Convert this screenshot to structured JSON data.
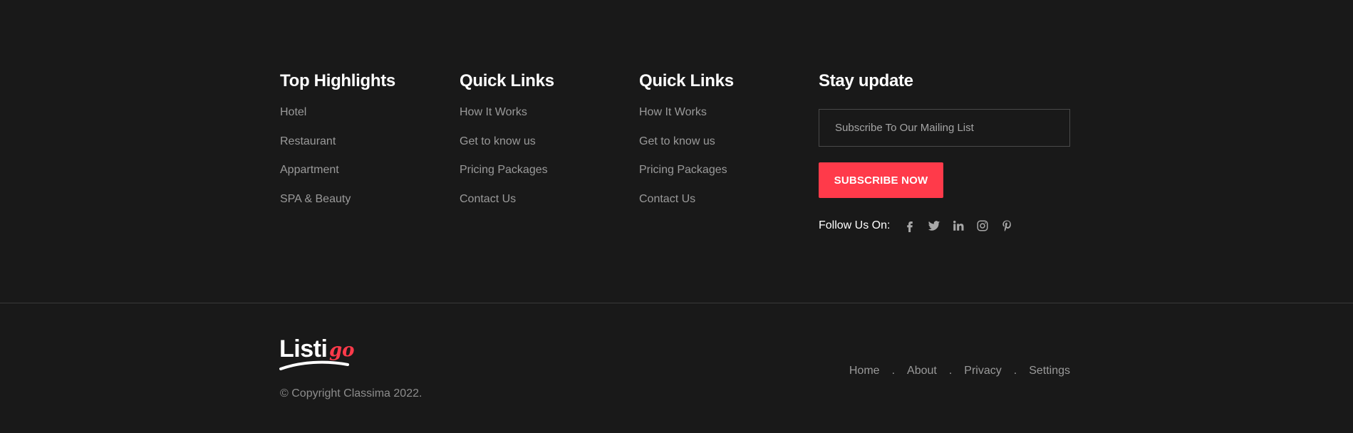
{
  "columns": [
    {
      "title": "Top Highlights",
      "links": [
        "Hotel",
        "Restaurant",
        "Appartment",
        "SPA & Beauty"
      ]
    },
    {
      "title": "Quick Links",
      "links": [
        "How It Works",
        "Get to know us",
        "Pricing Packages",
        "Contact Us"
      ]
    },
    {
      "title": "Quick Links",
      "links": [
        "How It Works",
        "Get to know us",
        "Pricing Packages",
        "Contact Us"
      ]
    }
  ],
  "subscribe": {
    "title": "Stay update",
    "placeholder": "Subscribe To Our Mailing List",
    "button_label": "SUBSCRIBE NOW",
    "follow_label": "Follow Us On:",
    "social_icons": [
      "facebook-icon",
      "twitter-icon",
      "linkedin-icon",
      "instagram-icon",
      "pinterest-icon"
    ]
  },
  "bottom": {
    "logo_text": "Listi",
    "logo_accent_text": "go",
    "copyright": "© Copyright Classima 2022.",
    "nav": [
      "Home",
      "About",
      "Privacy",
      "Settings"
    ],
    "separator": "."
  },
  "colors": {
    "background": "#191919",
    "accent": "#ff3a4a",
    "heading": "#ffffff",
    "link": "#9a9a9a"
  }
}
